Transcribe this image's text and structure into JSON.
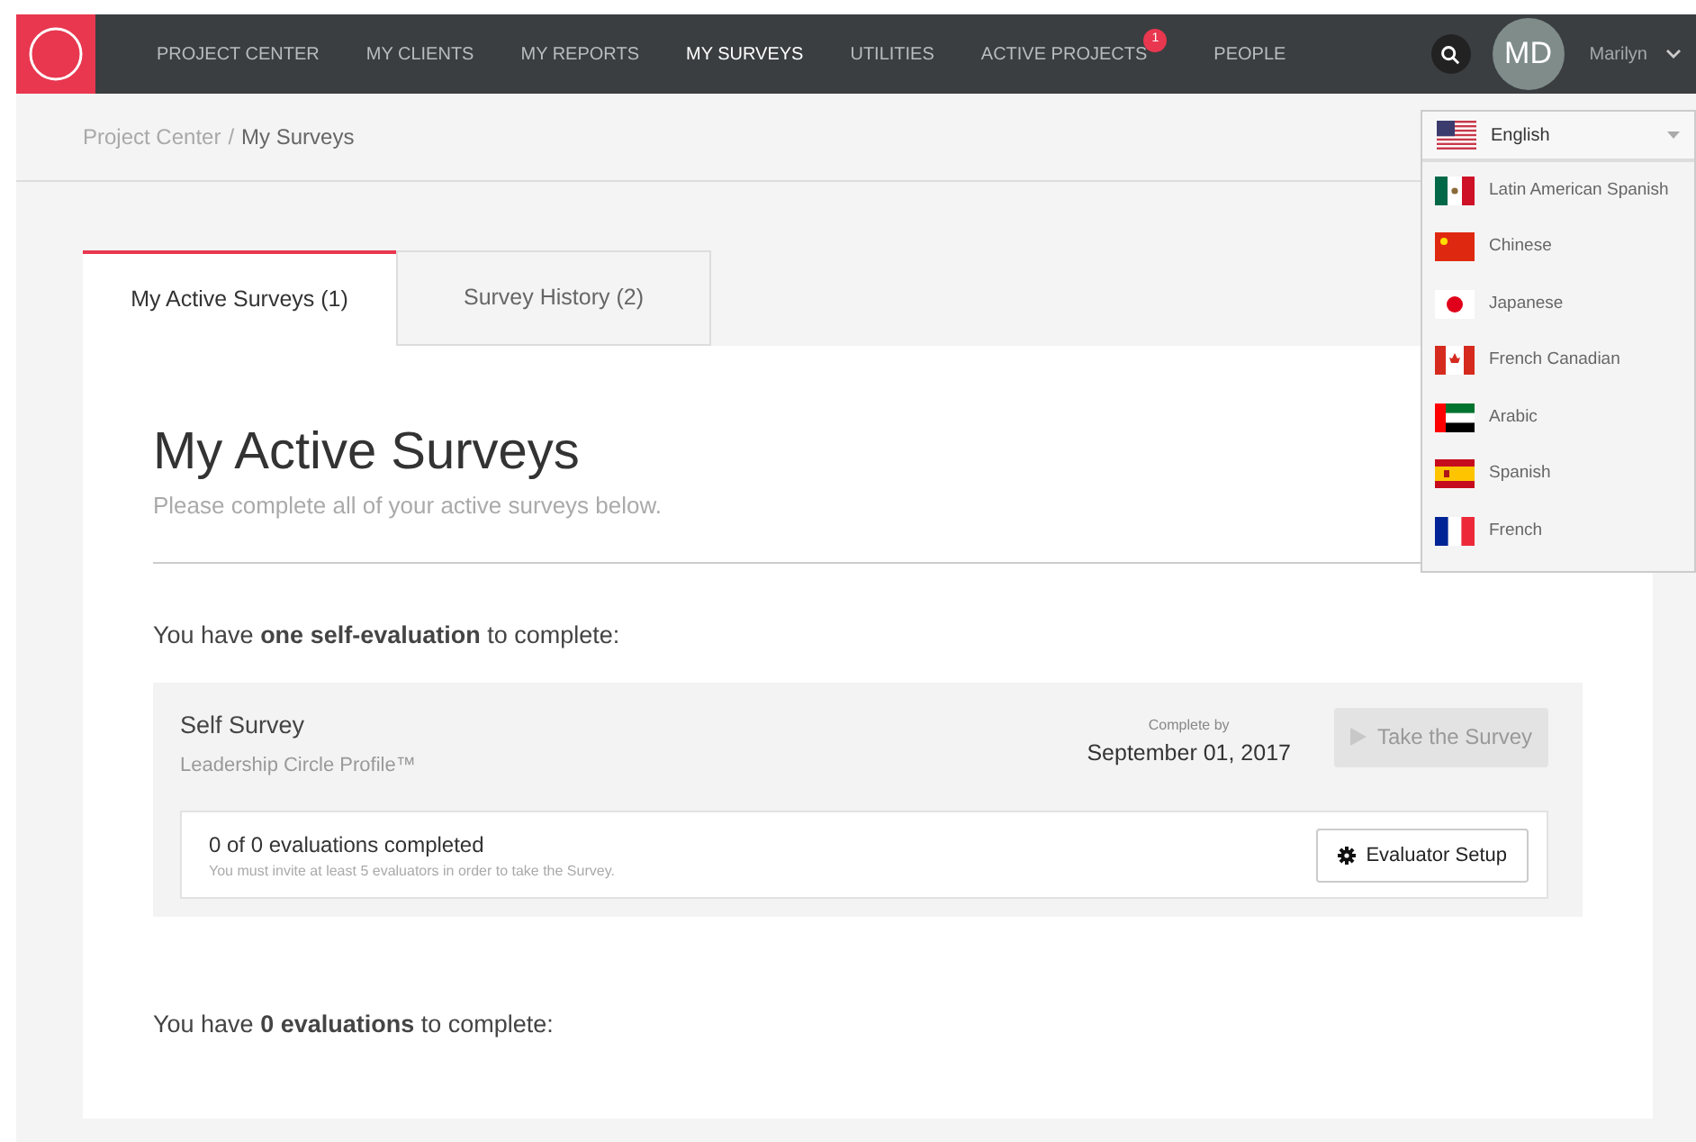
{
  "nav": {
    "items": [
      {
        "label": "PROJECT CENTER",
        "selected": false
      },
      {
        "label": "MY CLIENTS",
        "selected": false
      },
      {
        "label": "MY REPORTS",
        "selected": false
      },
      {
        "label": "MY SURVEYS",
        "selected": true
      },
      {
        "label": "UTILITIES",
        "selected": false
      },
      {
        "label": "ACTIVE PROJECTS",
        "selected": false,
        "badge": "1"
      },
      {
        "label": "PEOPLE",
        "selected": false
      }
    ],
    "avatar": "MD",
    "user": "Marilyn"
  },
  "breadcrumb": {
    "items": [
      "Project Center",
      "My Surveys"
    ],
    "separator": "/"
  },
  "language": {
    "value": "English",
    "expanded": true,
    "options": [
      "Latin American Spanish",
      "Chinese",
      "Japanese",
      "French Canadian",
      "Arabic",
      "Spanish",
      "French"
    ]
  },
  "tabs": [
    {
      "label": "My Active Surveys (1)",
      "selected": true
    },
    {
      "label": "Survey History (2)",
      "selected": false
    }
  ],
  "title": "My Active Surveys",
  "subtitle": "Please complete all of your active surveys below.",
  "self_heading": "You have **one self-evaluation** to complete:",
  "surveys": [
    {
      "name": "Self Survey",
      "product": "Leadership Circle Profile™",
      "due_label": "Complete by",
      "due_date": "September 01, 2017",
      "action": "Take the Survey",
      "disabled": true,
      "progress": "0 of 0 evaluations completed",
      "note": "You must invite at least 5 evaluators in order to take the Survey.",
      "setup": "Evaluator Setup"
    }
  ],
  "eval_heading": "You have **0 evaluations** to complete:"
}
